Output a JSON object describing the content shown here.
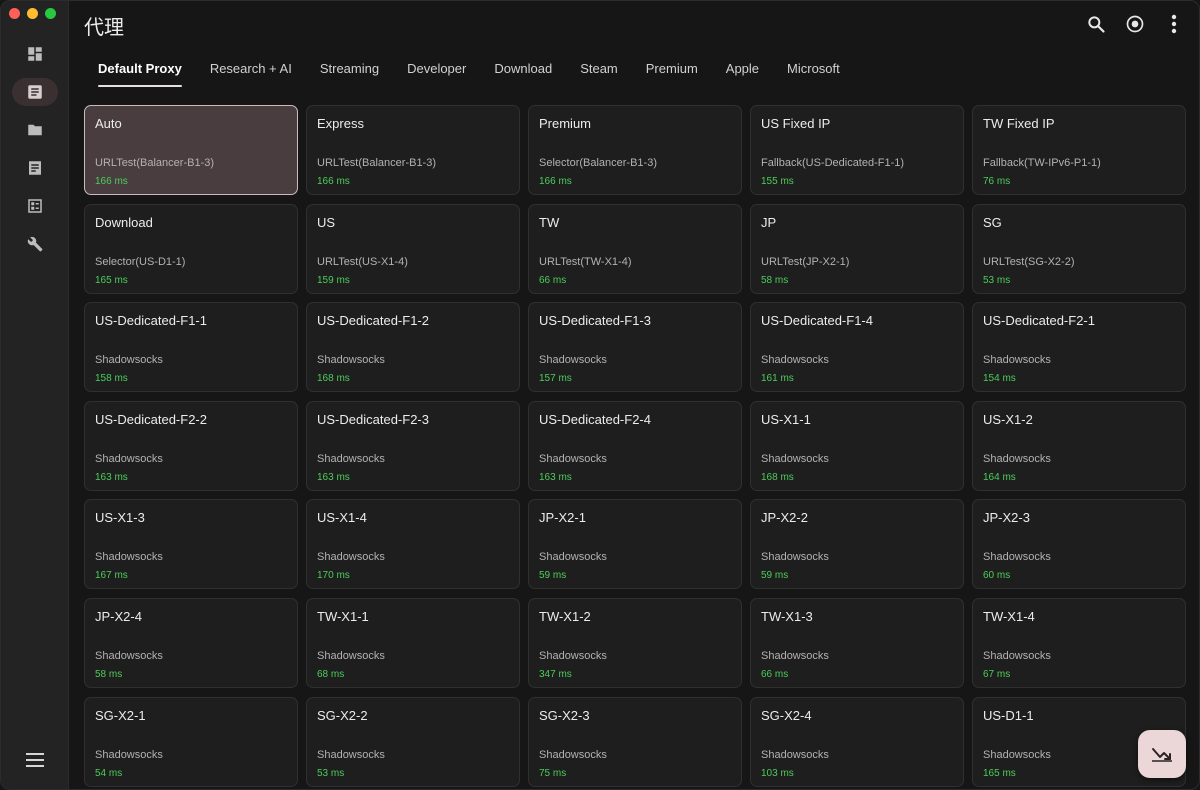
{
  "header": {
    "title": "代理"
  },
  "tabs": [
    {
      "label": "Default Proxy",
      "active": true
    },
    {
      "label": "Research + AI"
    },
    {
      "label": "Streaming"
    },
    {
      "label": "Developer"
    },
    {
      "label": "Download"
    },
    {
      "label": "Steam"
    },
    {
      "label": "Premium"
    },
    {
      "label": "Apple"
    },
    {
      "label": "Microsoft"
    }
  ],
  "sidebar": {
    "items": [
      {
        "icon": "dashboard-icon",
        "active": false
      },
      {
        "icon": "proxy-list-icon",
        "active": true
      },
      {
        "icon": "folder-icon",
        "active": false
      },
      {
        "icon": "logs-icon",
        "active": false
      },
      {
        "icon": "rules-icon",
        "active": false
      },
      {
        "icon": "tools-icon",
        "active": false
      }
    ]
  },
  "cards": [
    {
      "name": "Auto",
      "type": "URLTest(Balancer-B1-3)",
      "delay": "166 ms",
      "selected": true
    },
    {
      "name": "Express",
      "type": "URLTest(Balancer-B1-3)",
      "delay": "166 ms"
    },
    {
      "name": "Premium",
      "type": "Selector(Balancer-B1-3)",
      "delay": "166 ms"
    },
    {
      "name": "US Fixed IP",
      "type": "Fallback(US-Dedicated-F1-1)",
      "delay": "155 ms"
    },
    {
      "name": "TW Fixed IP",
      "type": "Fallback(TW-IPv6-P1-1)",
      "delay": "76 ms"
    },
    {
      "name": "Download",
      "type": "Selector(US-D1-1)",
      "delay": "165 ms"
    },
    {
      "name": "US",
      "type": "URLTest(US-X1-4)",
      "delay": "159 ms"
    },
    {
      "name": "TW",
      "type": "URLTest(TW-X1-4)",
      "delay": "66 ms"
    },
    {
      "name": "JP",
      "type": "URLTest(JP-X2-1)",
      "delay": "58 ms"
    },
    {
      "name": "SG",
      "type": "URLTest(SG-X2-2)",
      "delay": "53 ms"
    },
    {
      "name": "US-Dedicated-F1-1",
      "type": "Shadowsocks",
      "delay": "158 ms"
    },
    {
      "name": "US-Dedicated-F1-2",
      "type": "Shadowsocks",
      "delay": "168 ms"
    },
    {
      "name": "US-Dedicated-F1-3",
      "type": "Shadowsocks",
      "delay": "157 ms"
    },
    {
      "name": "US-Dedicated-F1-4",
      "type": "Shadowsocks",
      "delay": "161 ms"
    },
    {
      "name": "US-Dedicated-F2-1",
      "type": "Shadowsocks",
      "delay": "154 ms"
    },
    {
      "name": "US-Dedicated-F2-2",
      "type": "Shadowsocks",
      "delay": "163 ms"
    },
    {
      "name": "US-Dedicated-F2-3",
      "type": "Shadowsocks",
      "delay": "163 ms"
    },
    {
      "name": "US-Dedicated-F2-4",
      "type": "Shadowsocks",
      "delay": "163 ms"
    },
    {
      "name": "US-X1-1",
      "type": "Shadowsocks",
      "delay": "168 ms"
    },
    {
      "name": "US-X1-2",
      "type": "Shadowsocks",
      "delay": "164 ms"
    },
    {
      "name": "US-X1-3",
      "type": "Shadowsocks",
      "delay": "167 ms"
    },
    {
      "name": "US-X1-4",
      "type": "Shadowsocks",
      "delay": "170 ms"
    },
    {
      "name": "JP-X2-1",
      "type": "Shadowsocks",
      "delay": "59 ms"
    },
    {
      "name": "JP-X2-2",
      "type": "Shadowsocks",
      "delay": "59 ms"
    },
    {
      "name": "JP-X2-3",
      "type": "Shadowsocks",
      "delay": "60 ms"
    },
    {
      "name": "JP-X2-4",
      "type": "Shadowsocks",
      "delay": "58 ms"
    },
    {
      "name": "TW-X1-1",
      "type": "Shadowsocks",
      "delay": "68 ms"
    },
    {
      "name": "TW-X1-2",
      "type": "Shadowsocks",
      "delay": "347 ms"
    },
    {
      "name": "TW-X1-3",
      "type": "Shadowsocks",
      "delay": "66 ms"
    },
    {
      "name": "TW-X1-4",
      "type": "Shadowsocks",
      "delay": "67 ms"
    },
    {
      "name": "SG-X2-1",
      "type": "Shadowsocks",
      "delay": "54 ms"
    },
    {
      "name": "SG-X2-2",
      "type": "Shadowsocks",
      "delay": "53 ms"
    },
    {
      "name": "SG-X2-3",
      "type": "Shadowsocks",
      "delay": "75 ms"
    },
    {
      "name": "SG-X2-4",
      "type": "Shadowsocks",
      "delay": "103 ms"
    },
    {
      "name": "US-D1-1",
      "type": "Shadowsocks",
      "delay": "165 ms"
    }
  ],
  "colors": {
    "background": "#161616",
    "sidebar": "#232323",
    "card": "#1e1e1e",
    "card_selected": "#4a3d3f",
    "delay_green": "#4ccd5a",
    "fab": "#ecd7d8"
  },
  "actions": {
    "search": "search-icon",
    "locate": "target-icon",
    "more": "more-vert-icon",
    "fab": "speed-test-icon"
  }
}
